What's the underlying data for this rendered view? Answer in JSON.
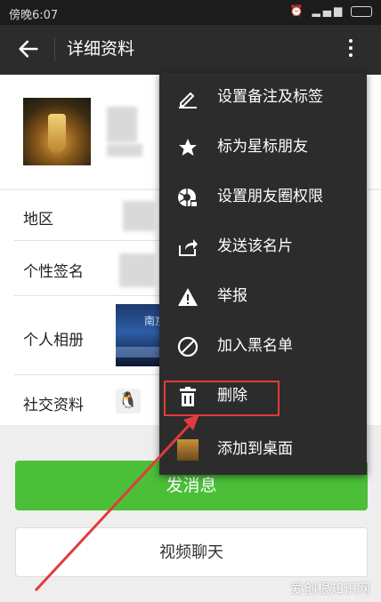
{
  "status_bar": {
    "time": "傍晚6:07"
  },
  "app_bar": {
    "title": "详细资料"
  },
  "profile": {
    "rows": [
      {
        "label": "地区"
      },
      {
        "label": "个性签名"
      },
      {
        "label": "个人相册"
      },
      {
        "label": "社交资料"
      }
    ],
    "album_text": "南京"
  },
  "actions": {
    "send_message": "发消息",
    "send_message_visible": "发消息",
    "video_chat": "视频聊天"
  },
  "menu": {
    "items": [
      {
        "label": "设置备注及标签",
        "icon": "edit-pencil-icon"
      },
      {
        "label": "标为星标朋友",
        "icon": "star-icon"
      },
      {
        "label": "设置朋友圈权限",
        "icon": "moments-privacy-icon"
      },
      {
        "label": "发送该名片",
        "icon": "share-icon"
      },
      {
        "label": "举报",
        "icon": "warning-icon"
      },
      {
        "label": "加入黑名单",
        "icon": "block-icon"
      },
      {
        "label": "删除",
        "icon": "trash-icon"
      },
      {
        "label": "添加到桌面",
        "icon": "add-to-desktop-icon"
      }
    ]
  },
  "annotation": {
    "highlight_color": "#e23b3b",
    "arrow_color": "#e23b3b"
  },
  "watermark": "爱创根知识网",
  "colors": {
    "accent_green": "#4cbf39",
    "menu_bg": "#2c2c2c",
    "appbar_bg": "#2c2c2c"
  }
}
